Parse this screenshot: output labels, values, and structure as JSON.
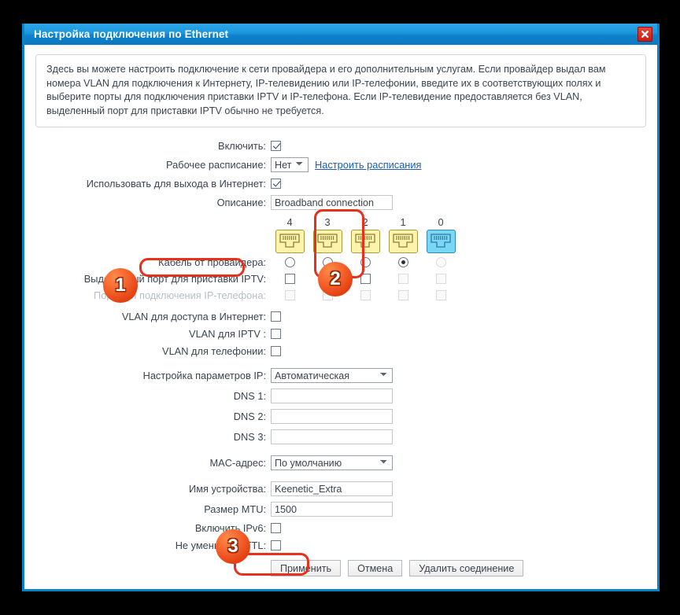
{
  "window": {
    "title": "Настройка подключения по Ethernet",
    "close_icon": "close-icon"
  },
  "info": {
    "text": "Здесь вы можете настроить подключение к сети провайдера и его дополнительным услугам. Если провайдер выдал вам номера VLAN для подключения к Интернету, IP-телевидению или IP-телефонии, введите их в соответствующих полях и выберите порты для подключения приставки IPTV и IP-телефона. Если IP-телевидение предоставляется без VLAN, выделенный порт для приставки IPTV обычно не требуется."
  },
  "form": {
    "enable_label": "Включить:",
    "enable_checked": true,
    "schedule_label": "Рабочее расписание:",
    "schedule_value": "Нет",
    "schedule_options": [
      "Нет"
    ],
    "schedule_link": "Настроить расписания",
    "use_internet_label": "Использовать для выхода в Интернет:",
    "use_internet_checked": true,
    "description_label": "Описание:",
    "description_value": "Broadband connection",
    "cable_label": "Кабель от провайдера:",
    "iptv_label": "Выделенный порт для приставки IPTV:",
    "ipphone_label": "Порт для подключения IP-телефона:",
    "vlan_internet_label": "VLAN для доступа в Интернет:",
    "vlan_internet_checked": false,
    "vlan_iptv_label": "VLAN для IPTV :",
    "vlan_iptv_checked": false,
    "vlan_phone_label": "VLAN для телефонии:",
    "vlan_phone_checked": false,
    "ip_settings_label": "Настройка параметров IP:",
    "ip_settings_value": "Автоматическая",
    "ip_settings_options": [
      "Автоматическая"
    ],
    "dns1_label": "DNS 1:",
    "dns1_value": "",
    "dns2_label": "DNS 2:",
    "dns2_value": "",
    "dns3_label": "DNS 3:",
    "dns3_value": "",
    "mac_label": "MAC-адрес:",
    "mac_value": "По умолчанию",
    "mac_options": [
      "По умолчанию"
    ],
    "device_name_label": "Имя устройства:",
    "device_name_value": "Keenetic_Extra",
    "mtu_label": "Размер MTU:",
    "mtu_value": "1500",
    "ipv6_label": "Включить IPv6:",
    "ipv6_checked": false,
    "ttl_label": "Не уменьшать TTL:",
    "ttl_checked": false
  },
  "ports": {
    "numbers": [
      "4",
      "3",
      "2",
      "1",
      "0"
    ],
    "types": [
      "lan",
      "lan",
      "lan",
      "lan",
      "wan"
    ],
    "cable_selected_index": 3,
    "iptv_enabled": [
      true,
      true,
      true,
      false,
      false
    ],
    "iptv_checked": [
      false,
      false,
      false,
      false,
      false
    ],
    "ipphone_enabled": [
      false,
      false,
      false,
      false,
      false
    ],
    "ipphone_checked": [
      false,
      false,
      false,
      false,
      false
    ]
  },
  "buttons": {
    "apply": "Применить",
    "cancel": "Отмена",
    "delete": "Удалить соединение"
  },
  "annotations": {
    "badge1": "1",
    "badge2": "2",
    "badge3": "3"
  },
  "colors": {
    "titlebar": "#0f83cc",
    "accent_border": "#0a82c8",
    "annotation_red": "#e8301a",
    "badge_orange": "#f4602a",
    "lan_port": "#fdf3ae",
    "wan_port": "#79d6f5",
    "link": "#1a5fb4"
  }
}
